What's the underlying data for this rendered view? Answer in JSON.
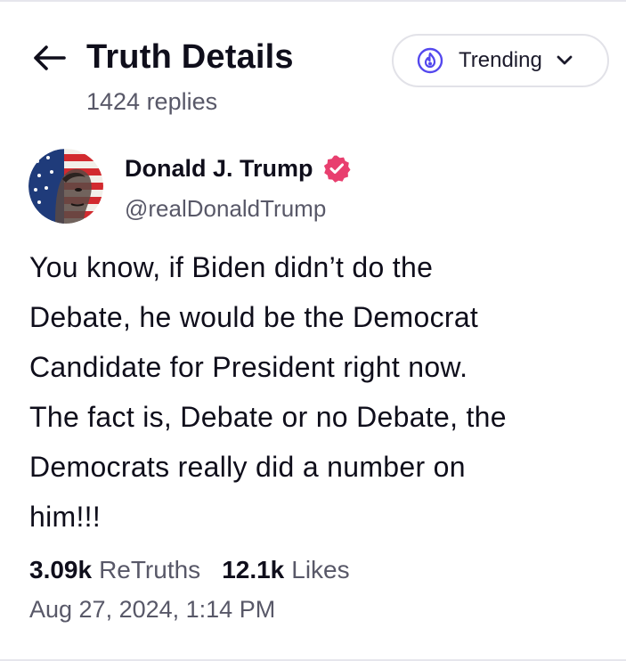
{
  "header": {
    "title": "Truth Details",
    "subtitle": "1424 replies",
    "back_icon": "arrow-left-icon",
    "sort": {
      "icon": "flame-icon",
      "label": "Trending",
      "chevron_icon": "chevron-down-icon"
    }
  },
  "post": {
    "author": {
      "display_name": "Donald J. Trump",
      "handle": "@realDonaldTrump",
      "verified_icon": "verified-badge-icon",
      "avatar": "avatar"
    },
    "lines": [
      "You know, if Biden didn’t do the",
      "Debate, he would be the Democrat",
      "Candidate for President right now.",
      "The fact is, Debate or no Debate, the",
      "Democrats really did a number on",
      "him!!!"
    ],
    "stats": {
      "retruths_value": "3.09k",
      "retruths_label": "ReTruths",
      "likes_value": "12.1k",
      "likes_label": "Likes"
    },
    "timestamp": "Aug 27, 2024, 1:14 PM"
  },
  "colors": {
    "text_primary": "#0f0e1b",
    "text_secondary": "#585868",
    "accent_purple": "#5448ee",
    "verified_pink": "#e83f6f",
    "border": "#e2e2e8"
  }
}
